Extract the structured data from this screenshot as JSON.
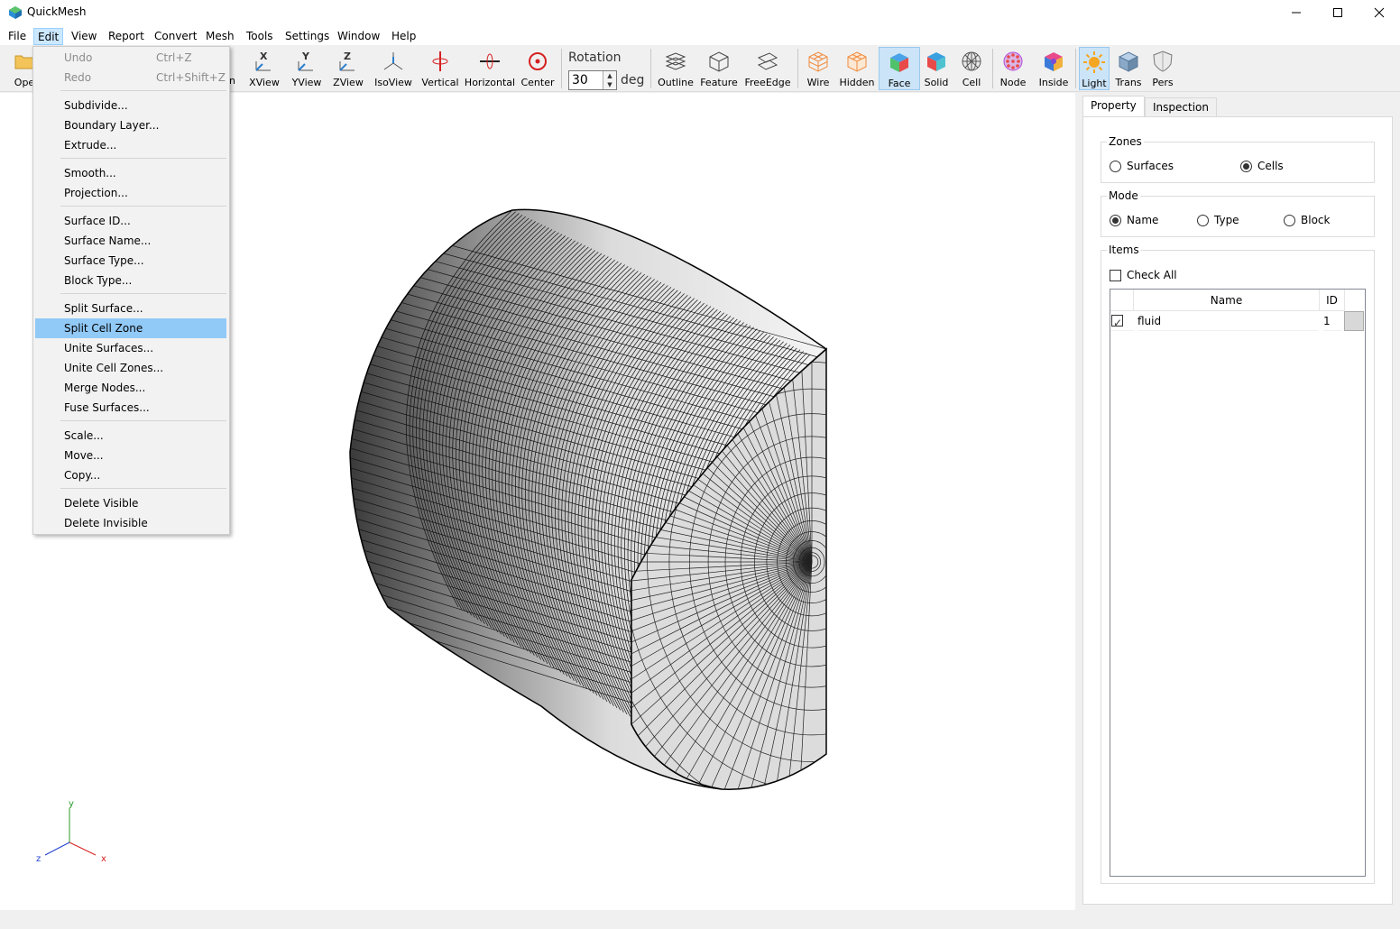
{
  "window": {
    "title": "QuickMesh"
  },
  "menubar": {
    "items": [
      {
        "label": "File"
      },
      {
        "label": "Edit"
      },
      {
        "label": "View"
      },
      {
        "label": "Report"
      },
      {
        "label": "Convert"
      },
      {
        "label": "Mesh"
      },
      {
        "label": "Tools"
      },
      {
        "label": "Settings"
      },
      {
        "label": "Window"
      },
      {
        "label": "Help"
      }
    ]
  },
  "toolbar": {
    "open_label": "Ope",
    "hidden_partial_label": "n",
    "buttons": [
      {
        "label": "XView",
        "icon": "xview-icon"
      },
      {
        "label": "YView",
        "icon": "yview-icon"
      },
      {
        "label": "ZView",
        "icon": "zview-icon"
      },
      {
        "label": "IsoView",
        "icon": "isoview-icon"
      },
      {
        "label": "Vertical",
        "icon": "vertical-rotate-icon"
      },
      {
        "label": "Horizontal",
        "icon": "horizontal-rotate-icon"
      },
      {
        "label": "Center",
        "icon": "center-target-icon"
      },
      {
        "label": "Outline",
        "icon": "outline-icon"
      },
      {
        "label": "Feature",
        "icon": "feature-cube-icon"
      },
      {
        "label": "FreeEdge",
        "icon": "freeedge-icon"
      },
      {
        "label": "Wire",
        "icon": "wire-cube-icon"
      },
      {
        "label": "Hidden",
        "icon": "hidden-cube-icon"
      },
      {
        "label": "Face",
        "icon": "face-cube-icon"
      },
      {
        "label": "Solid",
        "icon": "solid-cube-icon"
      },
      {
        "label": "Cell",
        "icon": "cell-sphere-icon"
      },
      {
        "label": "Node",
        "icon": "node-sphere-icon"
      },
      {
        "label": "Inside",
        "icon": "inside-cube-icon"
      },
      {
        "label": "Light",
        "icon": "light-sun-icon"
      },
      {
        "label": "Trans",
        "icon": "transparent-cube-icon"
      },
      {
        "label": "Pers",
        "icon": "perspective-shield-icon"
      }
    ],
    "rotation": {
      "label": "Rotation",
      "value": "30",
      "unit": "deg"
    }
  },
  "edit_menu": {
    "undo": {
      "label": "Undo",
      "shortcut": "Ctrl+Z"
    },
    "redo": {
      "label": "Redo",
      "shortcut": "Ctrl+Shift+Z"
    },
    "subdivide": "Subdivide...",
    "boundary_layer": "Boundary Layer...",
    "extrude": "Extrude...",
    "smooth": "Smooth...",
    "projection": "Projection...",
    "surface_id": "Surface ID...",
    "surface_name": "Surface Name...",
    "surface_type": "Surface Type...",
    "block_type": "Block Type...",
    "split_surface": "Split Surface...",
    "split_cell_zone": "Split Cell Zone",
    "unite_surfaces": "Unite Surfaces...",
    "unite_cell_zones": "Unite Cell Zones...",
    "merge_nodes": "Merge Nodes...",
    "fuse_surfaces": "Fuse Surfaces...",
    "scale": "Scale...",
    "move": "Move...",
    "copy": "Copy...",
    "delete_visible": "Delete Visible",
    "delete_invisible": "Delete Invisible"
  },
  "panel": {
    "tabs": {
      "property": "Property",
      "inspection": "Inspection"
    },
    "zones": {
      "title": "Zones",
      "surfaces": "Surfaces",
      "cells": "Cells",
      "selected": "Cells"
    },
    "mode": {
      "title": "Mode",
      "name": "Name",
      "type": "Type",
      "block": "Block",
      "selected": "Name"
    },
    "items": {
      "title": "Items",
      "check_all": "Check All",
      "col_name": "Name",
      "col_id": "ID",
      "rows": [
        {
          "name": "fluid",
          "id": "1",
          "checked": true
        }
      ]
    }
  },
  "axes": {
    "x": "x",
    "y": "y",
    "z": "z"
  },
  "colors": {
    "accent": "#91c9f7",
    "active_btn": "#cce4f7",
    "menu_open": "#cce8ff"
  }
}
